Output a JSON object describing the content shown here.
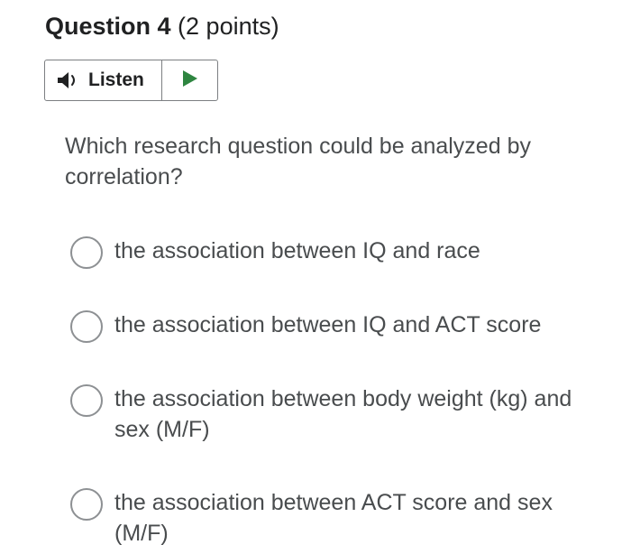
{
  "question": {
    "title": "Question 4",
    "points": "(2 points)",
    "text": "Which research question could be analyzed by correlation?"
  },
  "listen": {
    "label": "Listen",
    "speaker_icon": "speaker-icon",
    "play_icon": "play-icon",
    "play_color": "#2e8540"
  },
  "options": [
    {
      "label": "the association between IQ and race",
      "selected": false
    },
    {
      "label": "the association between IQ and ACT score",
      "selected": false
    },
    {
      "label": "the association between body weight (kg) and sex (M/F)",
      "selected": false
    },
    {
      "label": "the association between ACT score and sex (M/F)",
      "selected": false
    }
  ]
}
